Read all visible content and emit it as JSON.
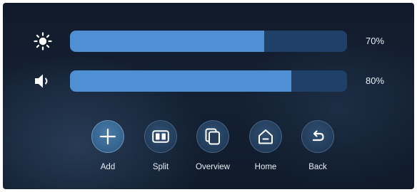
{
  "sliders": {
    "brightness": {
      "icon": "brightness-sun-icon",
      "value": 70,
      "label": "70%"
    },
    "volume": {
      "icon": "speaker-volume-icon",
      "value": 80,
      "label": "80%"
    }
  },
  "buttons": [
    {
      "id": "add",
      "label": "Add",
      "icon": "plus-icon"
    },
    {
      "id": "split",
      "label": "Split",
      "icon": "split-screen-icon"
    },
    {
      "id": "overview",
      "label": "Overview",
      "icon": "overview-stack-icon"
    },
    {
      "id": "home",
      "label": "Home",
      "icon": "home-icon"
    },
    {
      "id": "back",
      "label": "Back",
      "icon": "back-arrow-icon"
    }
  ],
  "colors": {
    "track": "#1f4068",
    "fill": "#4f8fd4",
    "text": "#e8edf3",
    "background": "#142133"
  }
}
